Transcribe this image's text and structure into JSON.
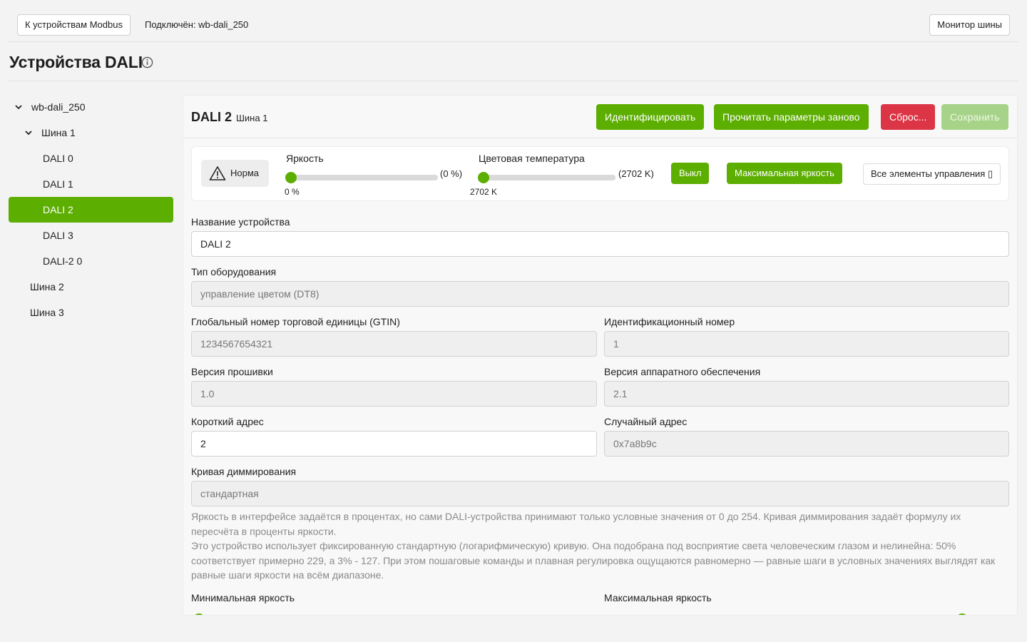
{
  "topbar": {
    "back_button": "К устройствам Modbus",
    "connected_label": "Подключён: wb-dali_250",
    "monitor_button": "Монитор шины"
  },
  "page": {
    "title": "Устройства DALI",
    "info_icon": "info-circle-icon"
  },
  "tree": {
    "root": "wb-dali_250",
    "bus1": "Шина 1",
    "devices": [
      "DALI 0",
      "DALI 1",
      "DALI 2",
      "DALI 3",
      "DALI-2 0"
    ],
    "bus2": "Шина 2",
    "bus3": "Шина 3",
    "selected": "DALI 2"
  },
  "device": {
    "title": "DALI 2",
    "bus": "Шина 1",
    "buttons": {
      "identify": "Идентифицировать",
      "reread": "Прочитать параметры заново",
      "reset": "Сброс...",
      "save": "Сохранить"
    }
  },
  "controls": {
    "status": "Норма",
    "status_icon": "warning-triangle-icon",
    "brightness": {
      "label": "Яркость",
      "value_text": "(0 %)",
      "under_text": "0 %",
      "level_percent": 0
    },
    "color_temp": {
      "label": "Цветовая температура",
      "value_text": "(2702 K)",
      "under_text": "2702 K",
      "level_percent": 0
    },
    "off_button": "Выкл",
    "max_button": "Максимальная яркость",
    "all_controls_button": "Все элементы управления ▯"
  },
  "form": {
    "name_label": "Название устройства",
    "name_value": "DALI 2",
    "type_label": "Тип оборудования",
    "type_value": "управление цветом (DT8)",
    "gtin_label": "Глобальный номер торговой единицы (GTIN)",
    "gtin_value": "1234567654321",
    "id_label": "Идентификационный номер",
    "id_value": "1",
    "fw_label": "Версия прошивки",
    "fw_value": "1.0",
    "hw_label": "Версия аппаратного обеспечения",
    "hw_value": "2.1",
    "short_label": "Короткий адрес",
    "short_value": "2",
    "random_label": "Случайный адрес",
    "random_value": "0x7a8b9c",
    "curve_label": "Кривая диммирования",
    "curve_value": "стандартная",
    "help_1": "Яркость в интерфейсе задаётся в процентах, но сами DALI-устройства принимают только условные значения от 0 до 254. Кривая диммирования задаёт формулу их пересчёта в проценты яркости.",
    "help_2": "Это устройство использует фиксированную стандартную (логарифмическую) кривую. Она подобрана под восприятие света человеческим глазом и нелинейна: 50% соответствует примерно 229, а 3% - 127. При этом пошаговые команды и плавная регулировка ощущаются равномерно — равные шаги в условных значениях выглядят как равные шаги яркости на всём диапазоне.",
    "min_label": "Минимальная яркость",
    "max_label": "Максимальная яркость"
  },
  "colors": {
    "accent": "#5cae00",
    "danger": "#dc3545",
    "disabled": "#a7d389"
  }
}
